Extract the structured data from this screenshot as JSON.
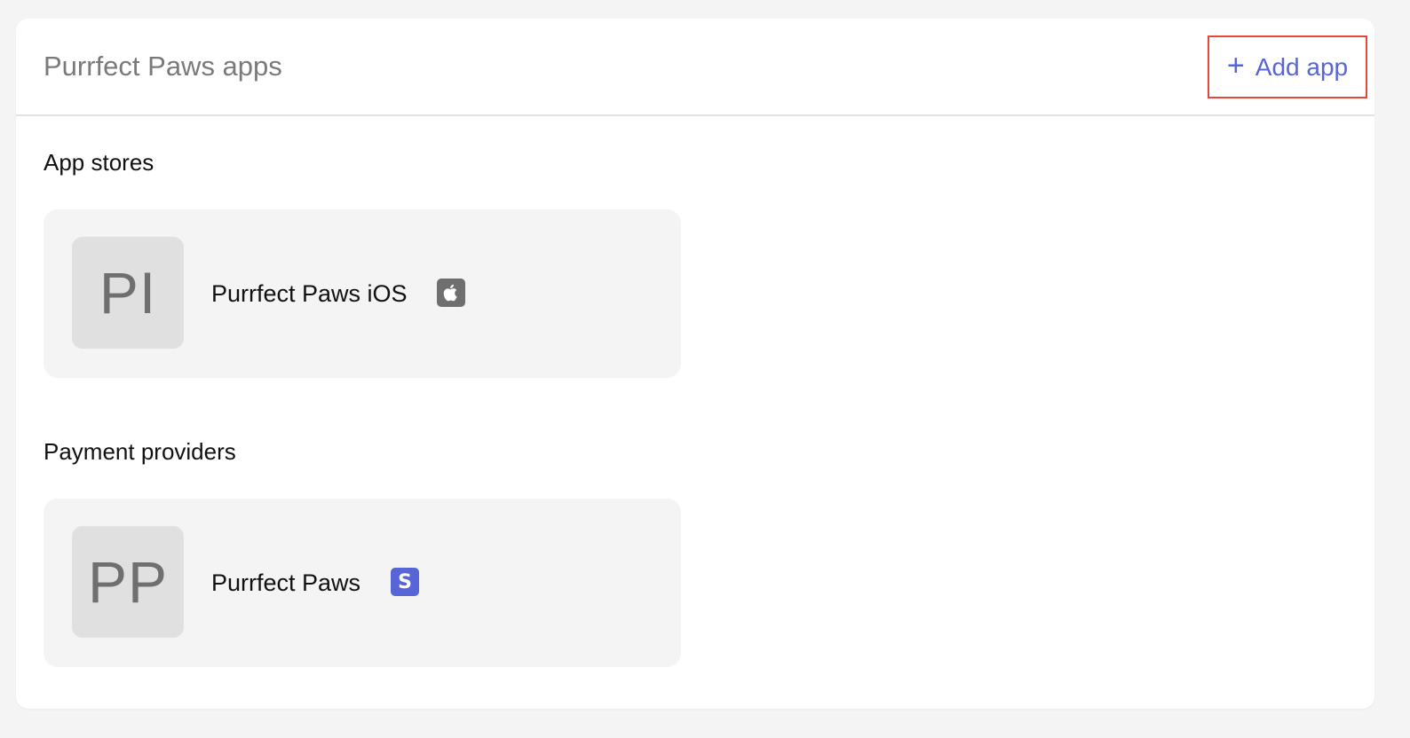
{
  "header": {
    "title": "Purrfect Paws apps",
    "add_button_label": "Add app",
    "add_button_icon": "plus-icon",
    "accent_color": "#5865d6",
    "highlight_color": "#e5483a"
  },
  "sections": [
    {
      "title": "App stores",
      "apps": [
        {
          "initials": "PI",
          "name": "Purrfect Paws iOS",
          "platform_icon": "apple-icon"
        }
      ]
    },
    {
      "title": "Payment providers",
      "apps": [
        {
          "initials": "PP",
          "name": "Purrfect Paws",
          "platform_icon": "stripe-icon",
          "platform_icon_letter": "S"
        }
      ]
    }
  ]
}
